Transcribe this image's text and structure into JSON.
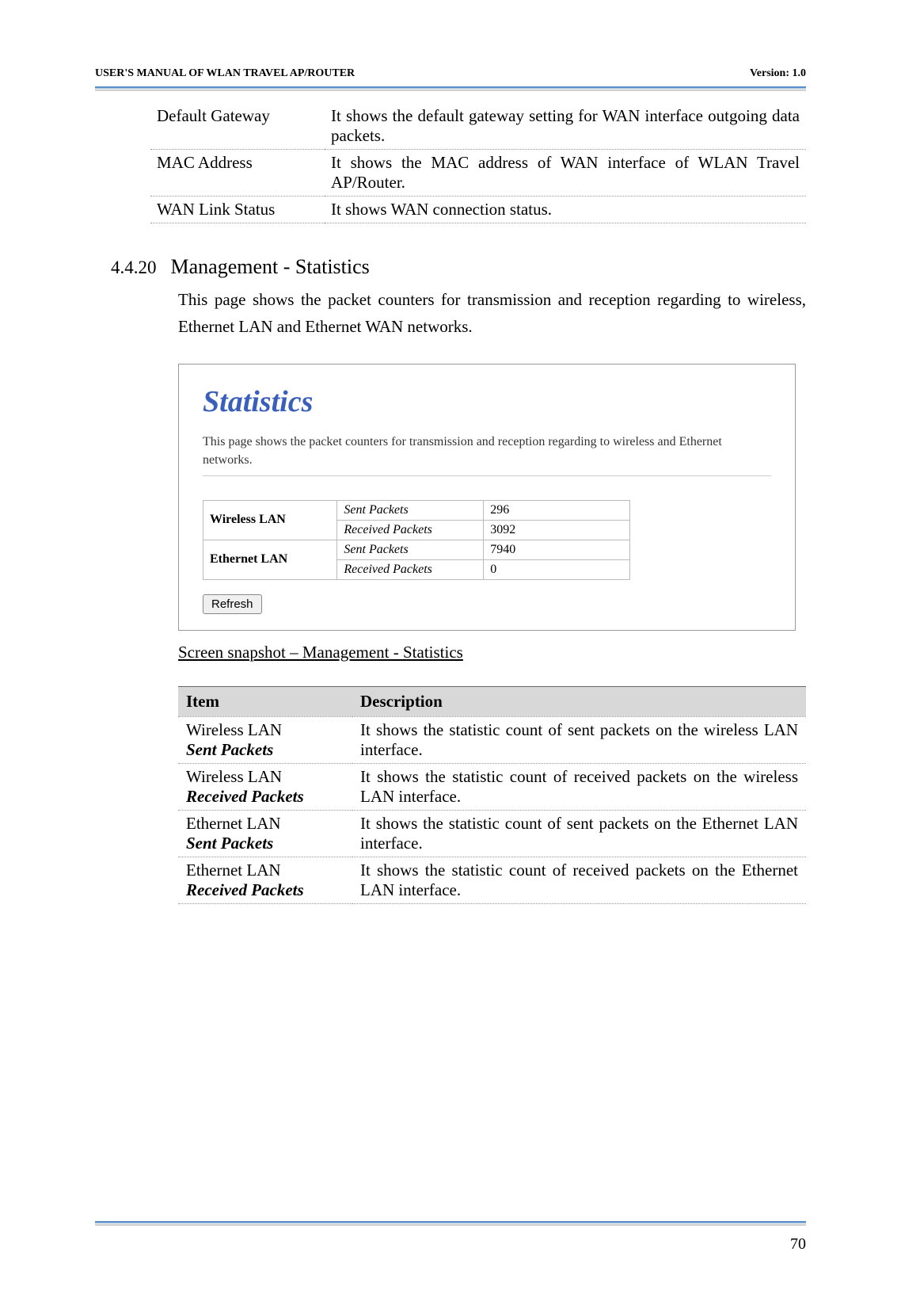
{
  "header": {
    "left": "USER'S MANUAL OF WLAN TRAVEL AP/ROUTER",
    "right": "Version: 1.0"
  },
  "top_table": [
    {
      "item": "Default Gateway",
      "desc": "It shows the default gateway setting for WAN interface outgoing data packets."
    },
    {
      "item": "MAC Address",
      "desc": "It shows the MAC address of WAN interface of WLAN Travel AP/Router."
    },
    {
      "item": "WAN Link Status",
      "desc": "It shows WAN connection status."
    }
  ],
  "section": {
    "number": "4.4.20",
    "title": "Management - Statistics",
    "body": "This page shows the packet counters for transmission and reception regarding to wireless, Ethernet LAN and Ethernet WAN networks."
  },
  "screenshot": {
    "title": "Statistics",
    "desc": "This page shows the packet counters for transmission and reception regarding to wireless and Ethernet networks.",
    "rows": [
      {
        "iface": "Wireless LAN",
        "metrics": [
          {
            "label": "Sent Packets",
            "value": "296"
          },
          {
            "label": "Received Packets",
            "value": "3092"
          }
        ]
      },
      {
        "iface": "Ethernet LAN",
        "metrics": [
          {
            "label": "Sent Packets",
            "value": "7940"
          },
          {
            "label": "Received Packets",
            "value": "0"
          }
        ]
      }
    ],
    "refresh": "Refresh"
  },
  "caption": "Screen snapshot – Management - Statistics",
  "desc_table": {
    "col1": "Item",
    "col2": "Description",
    "rows": [
      {
        "item1": "Wireless LAN",
        "item2": "Sent Packets",
        "desc": "It shows the statistic count of sent packets on the wireless LAN interface."
      },
      {
        "item1": "Wireless LAN",
        "item2": "Received Packets",
        "desc": "It shows the statistic count of received packets on the wireless LAN interface."
      },
      {
        "item1": "Ethernet LAN",
        "item2": "Sent Packets",
        "desc": "It shows the statistic count of sent packets on the Ethernet LAN interface."
      },
      {
        "item1": "Ethernet LAN",
        "item2": "Received Packets",
        "desc": "It shows the statistic count of received packets on the Ethernet LAN interface."
      }
    ]
  },
  "page_number": "70"
}
